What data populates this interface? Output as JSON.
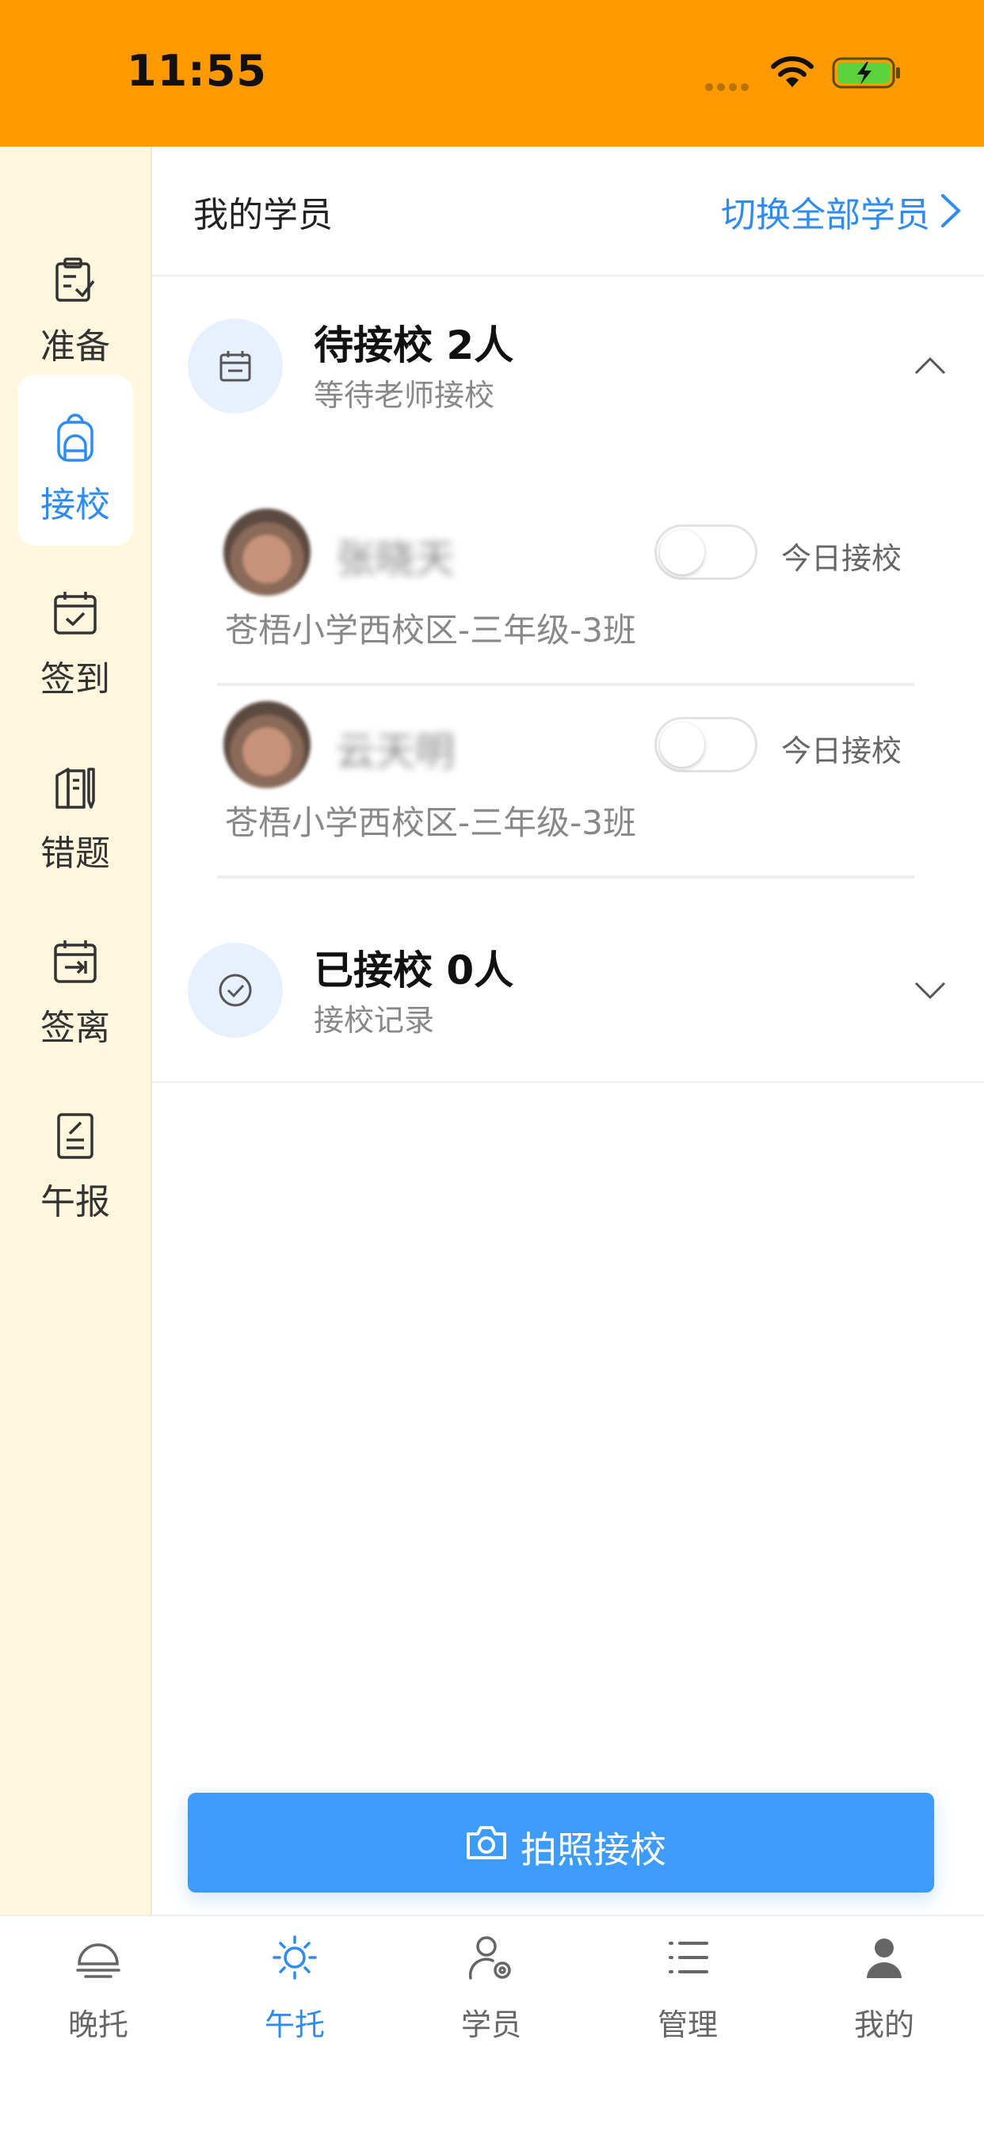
{
  "status_bar": {
    "time": "11:55"
  },
  "side_nav": {
    "items": [
      {
        "label": "准备",
        "icon": "clipboard-check-icon",
        "active": false
      },
      {
        "label": "接校",
        "icon": "backpack-icon",
        "active": true
      },
      {
        "label": "签到",
        "icon": "calendar-check-icon",
        "active": false
      },
      {
        "label": "错题",
        "icon": "book-pen-icon",
        "active": false
      },
      {
        "label": "签离",
        "icon": "calendar-exit-icon",
        "active": false
      },
      {
        "label": "午报",
        "icon": "report-icon",
        "active": false
      }
    ]
  },
  "header": {
    "title": "我的学员",
    "switch_link": "切换全部学员"
  },
  "pending": {
    "title": "待接校 2人",
    "subtitle": "等待老师接校",
    "students": [
      {
        "name": "张晓天",
        "school": "苍梧小学西校区-三年级-3班",
        "toggle_label": "今日接校",
        "toggle_on": false
      },
      {
        "name": "云天明",
        "school": "苍梧小学西校区-三年级-3班",
        "toggle_label": "今日接校",
        "toggle_on": false
      }
    ]
  },
  "done": {
    "title": "已接校 0人",
    "subtitle": "接校记录"
  },
  "action_button": {
    "label": "拍照接校"
  },
  "tab_bar": {
    "items": [
      {
        "label": "晚托",
        "icon": "lamp-icon",
        "active": false
      },
      {
        "label": "午托",
        "icon": "sun-icon",
        "active": true
      },
      {
        "label": "学员",
        "icon": "user-gear-icon",
        "active": false
      },
      {
        "label": "管理",
        "icon": "list-icon",
        "active": false
      },
      {
        "label": "我的",
        "icon": "person-icon",
        "active": false
      }
    ]
  },
  "colors": {
    "status_bar": "#FF9900",
    "accent": "#2E8BF0",
    "side_bg": "#FFF6DE",
    "button": "#3D9BFA"
  }
}
